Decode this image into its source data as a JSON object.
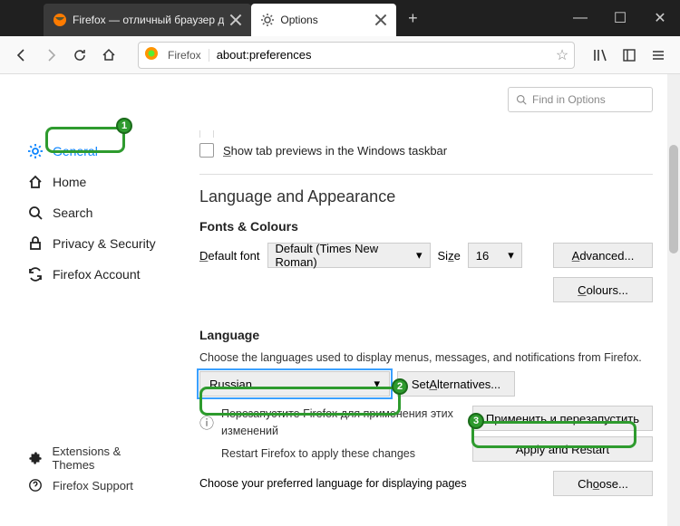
{
  "window": {
    "tabs": [
      {
        "label": "Firefox — отличный браузер д"
      },
      {
        "label": "Options"
      }
    ],
    "newtab_glyph": "+",
    "min": "—",
    "max": "☐",
    "close": "✕"
  },
  "toolbar": {
    "firefox_label": "Firefox",
    "url": "about:preferences",
    "star": "☆"
  },
  "find": {
    "placeholder": "Find in Options",
    "icon": "🔍"
  },
  "sidebar": {
    "items": [
      {
        "key": "general",
        "label": "General"
      },
      {
        "key": "home",
        "label": "Home"
      },
      {
        "key": "search",
        "label": "Search"
      },
      {
        "key": "privacy",
        "label": "Privacy & Security"
      },
      {
        "key": "account",
        "label": "Firefox Account"
      }
    ],
    "bottom": [
      {
        "key": "ext",
        "label": "Extensions & Themes"
      },
      {
        "key": "support",
        "label": "Firefox Support"
      }
    ]
  },
  "top_checks": {
    "cutoff_first": "S",
    "cutoff_rest": "how tab previews in the Windows taskbar"
  },
  "fonts": {
    "section_title": "Language and Appearance",
    "sub": "Fonts & Colours",
    "default_first": "D",
    "default_rest": "efault font",
    "font_value": "Default (Times New Roman)",
    "size_first": "Si",
    "size_u": "z",
    "size_rest": "e",
    "size_value": "16",
    "advanced_u": "A",
    "advanced_rest": "dvanced...",
    "colours_u": "C",
    "colours_rest": "olours..."
  },
  "lang": {
    "sub": "Language",
    "desc": "Choose the languages used to display menus, messages, and notifications from Firefox.",
    "select_value": "Russian",
    "alt_pre": "Set ",
    "alt_u": "A",
    "alt_rest": "lternatives...",
    "info_icon": "ⓘ",
    "restart_ru": "Перезапустите Firefox для применения этих изменений",
    "restart_en": "Restart Firefox to apply these changes",
    "apply_ru": "Применить и перезапустить",
    "apply_en": "Apply and Restart",
    "choose_desc": "Choose your preferred language for displaying pages",
    "choose_u": "o",
    "choose_pre": "Ch",
    "choose_rest": "ose..."
  },
  "callouts": {
    "b1": "1",
    "b2": "2",
    "b3": "3"
  }
}
